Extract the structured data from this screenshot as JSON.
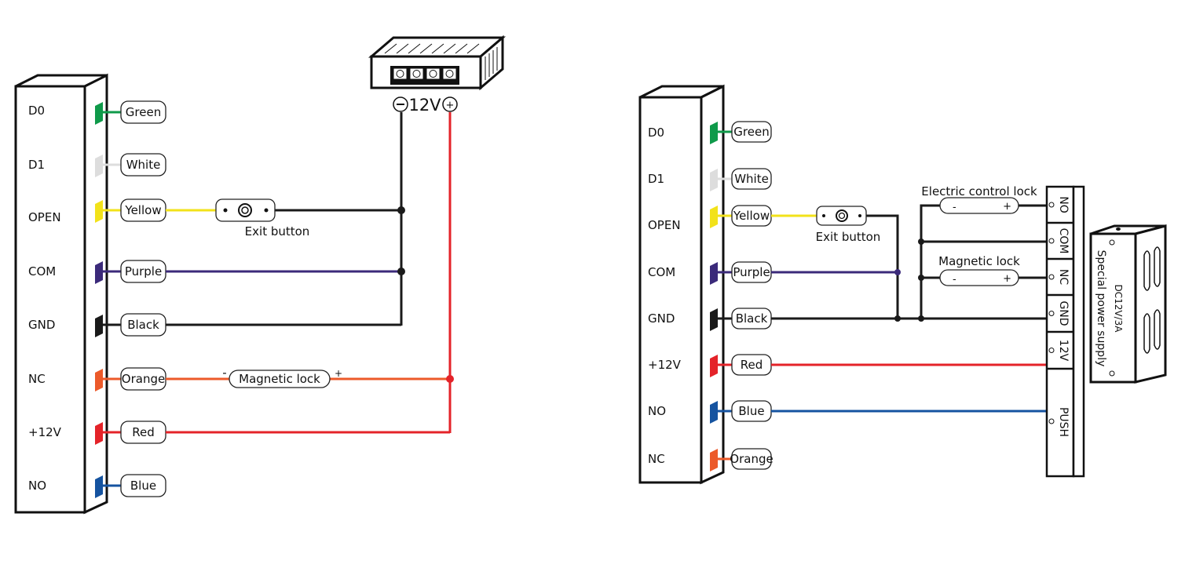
{
  "colors": {
    "green": "#0f9a4a",
    "white": "#dddddd",
    "yellow": "#f2e21a",
    "purple": "#3b2a7a",
    "black": "#1a1a1a",
    "orange": "#ec5a2a",
    "red": "#e42329",
    "blue": "#1553a0"
  },
  "left": {
    "pins": [
      "D0",
      "D1",
      "OPEN",
      "COM",
      "GND",
      "NC",
      "+12V",
      "NO"
    ],
    "wires": [
      "Green",
      "White",
      "Yellow",
      "Purple",
      "Black",
      "Orange",
      "Red",
      "Blue"
    ],
    "exit_button": "Exit button",
    "magnetic_lock": "Magnetic lock",
    "minus": "-",
    "plus": "+",
    "psu_label": "12V"
  },
  "right": {
    "pins": [
      "D0",
      "D1",
      "OPEN",
      "COM",
      "GND",
      "+12V",
      "NO",
      "NC"
    ],
    "wires": [
      "Green",
      "White",
      "Yellow",
      "Purple",
      "Black",
      "Red",
      "Blue",
      "Orange"
    ],
    "exit_button": "Exit button",
    "electric_lock": "Electric control lock",
    "magnetic_lock": "Magnetic lock",
    "minus": "-",
    "plus": "+",
    "terminals": [
      "NO",
      "COM",
      "NC",
      "GND",
      "12V",
      "PUSH"
    ],
    "psu_rating": "DC12V/3A",
    "psu_name": "Special power supply"
  }
}
